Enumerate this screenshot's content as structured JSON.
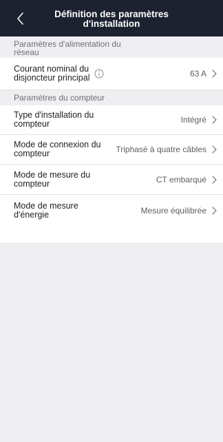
{
  "header": {
    "title_line1": "Définition des paramètres",
    "title_line2": "d'installation"
  },
  "sections": {
    "grid": {
      "title_line1": "Paramètres d'alimentation du",
      "title_line2": "réseau"
    },
    "meter": {
      "title": "Paramètres du compteur"
    }
  },
  "rows": {
    "breaker": {
      "label_line1": "Courant nominal du",
      "label_line2": "disjoncteur principal",
      "value": "63 A"
    },
    "meter_install": {
      "label_line1": "Type d'installation du",
      "label_line2": "compteur",
      "value": "Intégré"
    },
    "connection": {
      "label_line1": "Mode de connexion du",
      "label_line2": "compteur",
      "value": "Triphasé à quatre câbles"
    },
    "measure": {
      "label_line1": "Mode de mesure du",
      "label_line2": "compteur",
      "value": "CT embarqué"
    },
    "energy": {
      "label_line1": "Mode de mesure",
      "label_line2": "d'énergie",
      "value": "Mesure équilibrée"
    }
  },
  "icons": {
    "back": "chevron-left-icon",
    "info": "info-circle-icon",
    "chevron": "chevron-right-icon"
  },
  "colors": {
    "header_bg": "#1d2230",
    "page_bg": "#efeff1",
    "row_bg": "#ffffff"
  }
}
